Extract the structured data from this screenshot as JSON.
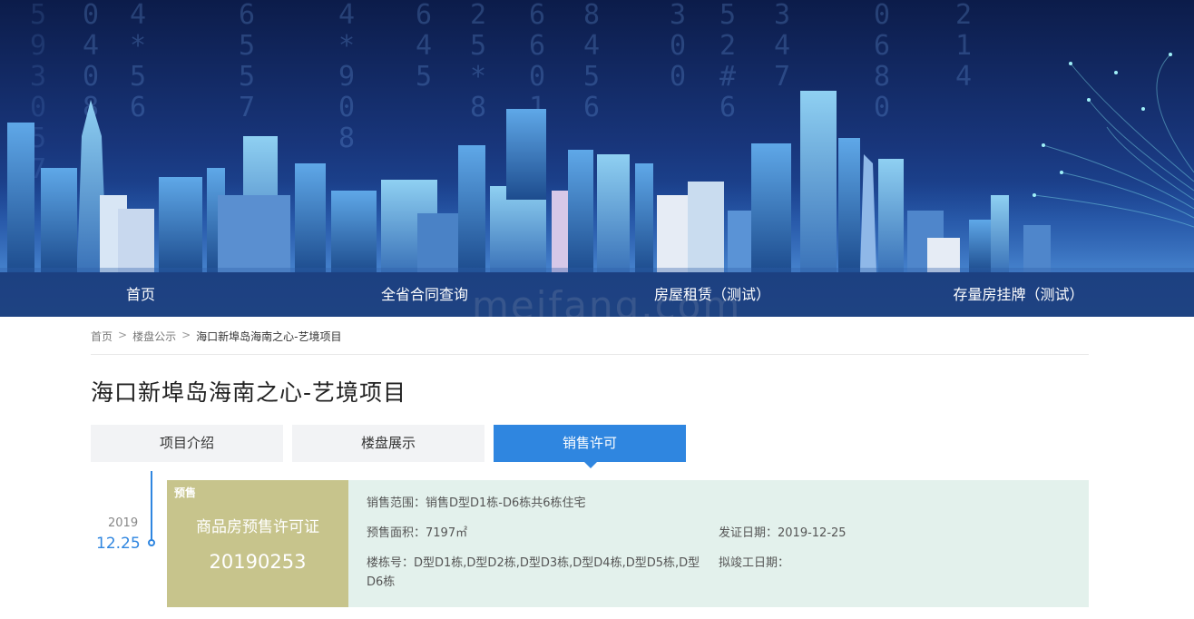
{
  "nav": {
    "items": [
      {
        "label": "首页"
      },
      {
        "label": "全省合同查询"
      },
      {
        "label": "房屋租赁（测试）"
      },
      {
        "label": "存量房挂牌（测试）"
      }
    ]
  },
  "watermark": "meifang.com",
  "breadcrumb": {
    "home": "首页",
    "sep": ">",
    "section": "楼盘公示",
    "current": "海口新埠岛海南之心-艺境项目"
  },
  "page_title": "海口新埠岛海南之心-艺境项目",
  "tabs": [
    {
      "label": "项目介绍",
      "active": false
    },
    {
      "label": "楼盘展示",
      "active": false
    },
    {
      "label": "销售许可",
      "active": true
    }
  ],
  "timeline": {
    "year": "2019",
    "date": "12.25"
  },
  "permit": {
    "tag": "预售",
    "type": "商品房预售许可证",
    "number": "20190253",
    "sale_scope": "销售范围：销售D型D1栋-D6栋共6栋住宅",
    "presale_area": "预售面积：7197㎡",
    "issue_date": "发证日期：2019-12-25",
    "buildings": "楼栋号：D型D1栋,D型D2栋,D型D3栋,D型D4栋,D型D5栋,D型D6栋",
    "completion_date": "拟竣工日期："
  },
  "colors": {
    "accent": "#2f86e0",
    "permit_left": "#c7c48c",
    "permit_right": "#e3f1ec"
  }
}
